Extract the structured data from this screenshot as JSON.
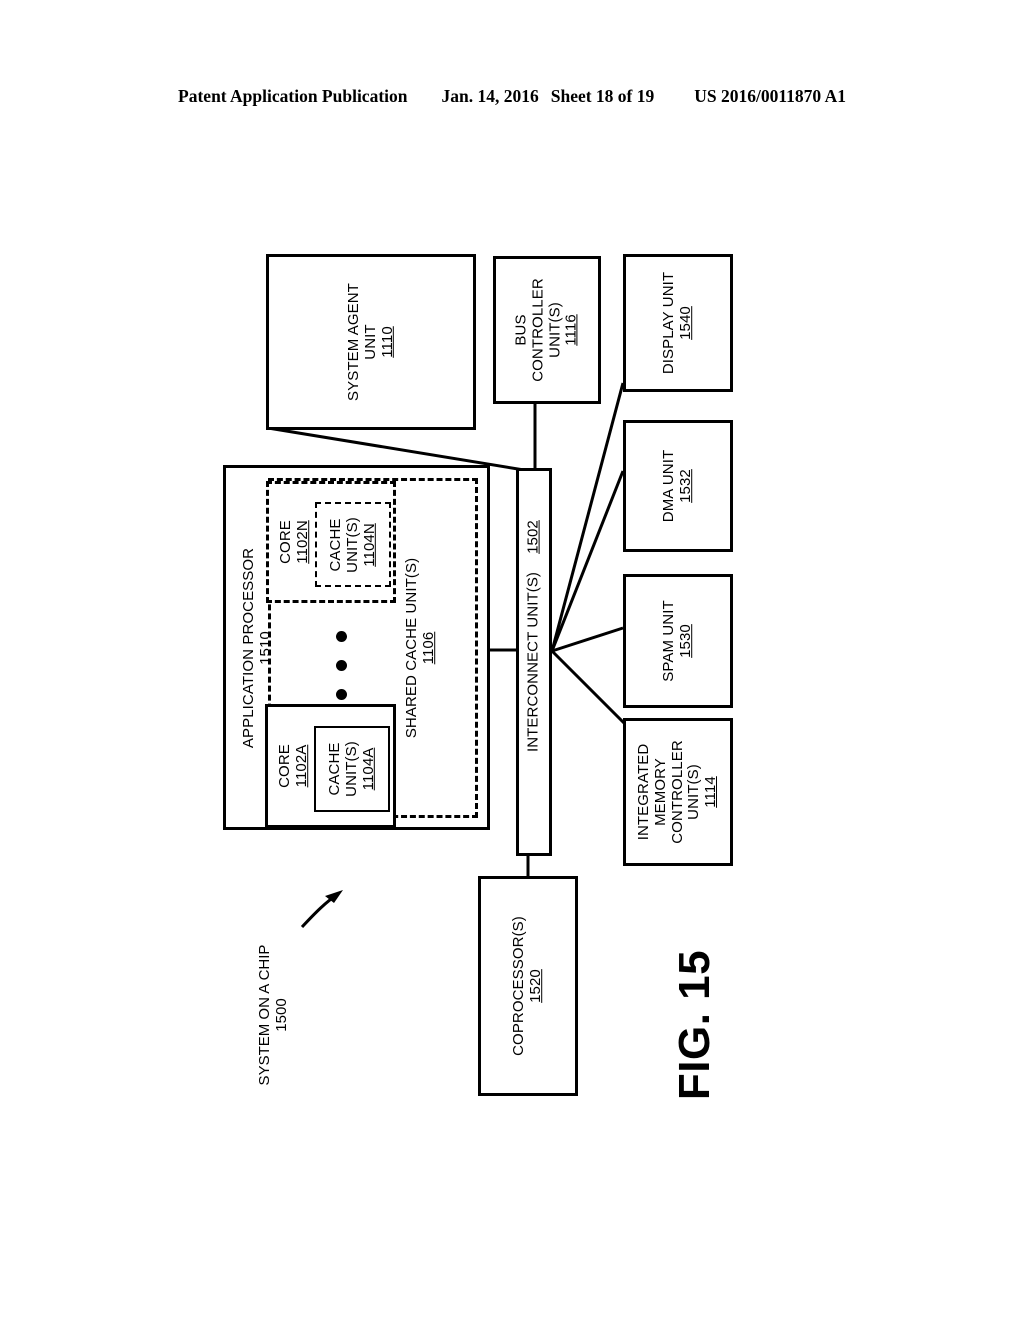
{
  "header": {
    "publication": "Patent Application Publication",
    "date": "Jan. 14, 2016",
    "sheet": "Sheet 18 of 19",
    "docket": "US 2016/0011870 A1"
  },
  "figure": {
    "caption": "FIG. 15",
    "callout": {
      "title": "SYSTEM ON A CHIP",
      "ref": "1500"
    },
    "blocks": {
      "system_agent": {
        "title": "SYSTEM AGENT",
        "line2": "UNIT",
        "ref": "1110"
      },
      "bus_controller": {
        "title": "BUS",
        "line2": "CONTROLLER",
        "line3": "UNIT(S)",
        "ref": "1116"
      },
      "display_unit": {
        "title": "DISPLAY UNIT",
        "ref": "1540"
      },
      "dma_unit": {
        "title": "DMA UNIT",
        "ref": "1532"
      },
      "spam_unit": {
        "title": "SPAM UNIT",
        "ref": "1530"
      },
      "imc_unit": {
        "title": "INTEGRATED",
        "line2": "MEMORY",
        "line3": "CONTROLLER",
        "line4": "UNIT(S)",
        "ref": "1114"
      },
      "app_processor": {
        "title": "APPLICATION PROCESSOR",
        "ref": "1510"
      },
      "core_a": {
        "title": "CORE",
        "ref": "1102A"
      },
      "cache_a": {
        "title": "CACHE",
        "line2": "UNIT(S)",
        "ref": "1104A"
      },
      "core_n": {
        "title": "CORE",
        "ref": "1102N"
      },
      "cache_n": {
        "title": "CACHE",
        "line2": "UNIT(S)",
        "ref": "1104N"
      },
      "shared_cache": {
        "title": "SHARED CACHE UNIT(S)",
        "ref": "1106"
      },
      "interconnect": {
        "title": "INTERCONNECT UNIT(S)",
        "ref": "1502"
      },
      "coprocessor": {
        "title": "COPROCESSOR(S)",
        "ref": "1520"
      }
    },
    "colors": {
      "ink": "#000000",
      "paper": "#ffffff"
    }
  }
}
